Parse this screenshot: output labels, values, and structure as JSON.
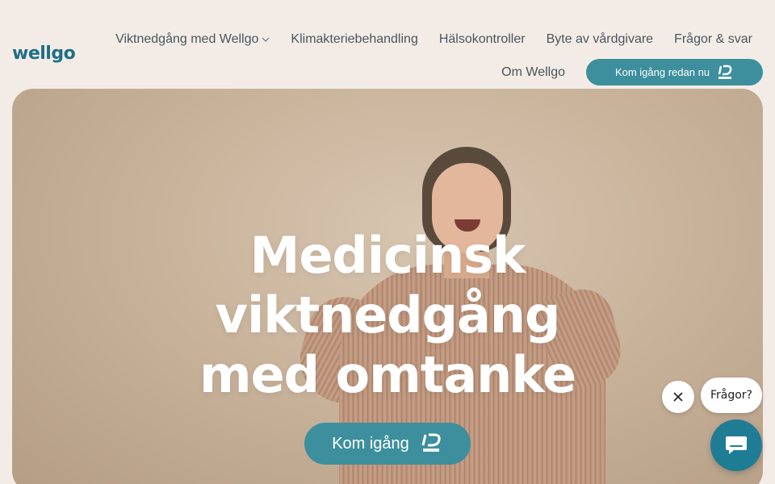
{
  "brand": {
    "logo_text": "wellgo",
    "accent": "#3d8f9d",
    "logo_color": "#1e6f86"
  },
  "nav": {
    "items": [
      {
        "label": "Viktnedgång med Wellgo",
        "has_dropdown": true
      },
      {
        "label": "Klimakteriebehandling"
      },
      {
        "label": "Hälsokontroller"
      },
      {
        "label": "Byte av vårdgivare"
      },
      {
        "label": "Frågor & svar"
      }
    ],
    "about_label": "Om Wellgo",
    "cta_label": "Kom igång redan nu",
    "cta_icon": "bankid-icon"
  },
  "hero": {
    "title_lines": [
      "Medicinsk",
      "viktnedgång",
      "med omtanke"
    ],
    "cta_label": "Kom igång",
    "cta_icon": "bankid-icon"
  },
  "chat": {
    "prompt": "Frågor?",
    "close_icon": "close-icon",
    "launcher_icon": "chat-icon"
  }
}
